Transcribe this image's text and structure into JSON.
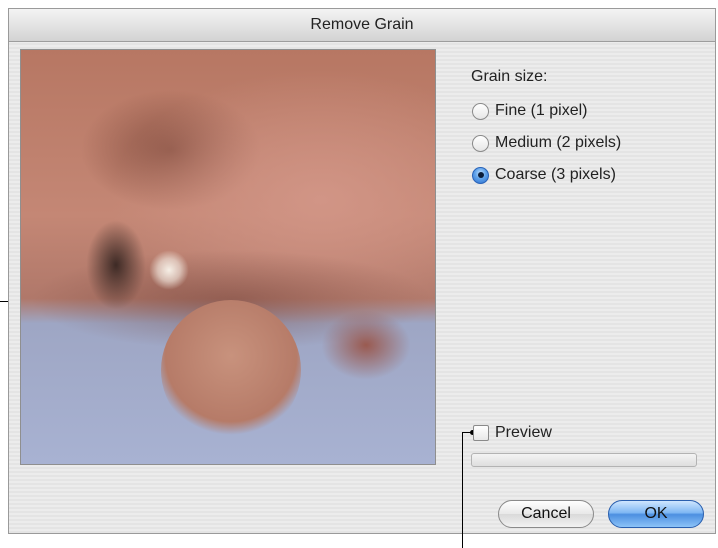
{
  "window": {
    "title": "Remove Grain"
  },
  "grain_size": {
    "label": "Grain size:",
    "options": [
      {
        "label": "Fine (1 pixel)",
        "selected": false
      },
      {
        "label": "Medium (2 pixels)",
        "selected": false
      },
      {
        "label": "Coarse (3 pixels)",
        "selected": true
      }
    ]
  },
  "preview": {
    "label": "Preview",
    "checked": false
  },
  "progress": {
    "value": 0
  },
  "buttons": {
    "cancel": "Cancel",
    "ok": "OK"
  },
  "colors": {
    "accent": "#4c8fe0"
  }
}
